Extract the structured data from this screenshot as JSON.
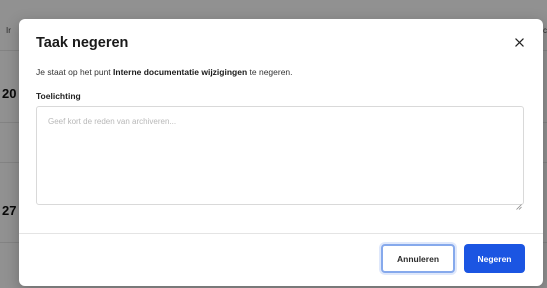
{
  "background": {
    "header_left": "Ir",
    "header_right": "c",
    "row1_fragment": "20",
    "row2_fragment": "27"
  },
  "dialog": {
    "title": "Taak negeren",
    "close_symbol": "×",
    "intro_before": "Je staat op het punt ",
    "intro_bold": "Interne documentatie wijzigingen",
    "intro_after": " te negeren.",
    "field_label": "Toelichting",
    "textarea": {
      "value": "",
      "placeholder": "Geef kort de reden van archiveren..."
    },
    "cancel_label": "Annuleren",
    "confirm_label": "Negeren"
  },
  "colors": {
    "primary": "#1b55e2",
    "focus_ring": "#86a9ec",
    "overlay": "rgba(0,0,0,0.43)"
  },
  "icons": {
    "close": "close-icon",
    "resize": "resize-handle-icon"
  }
}
